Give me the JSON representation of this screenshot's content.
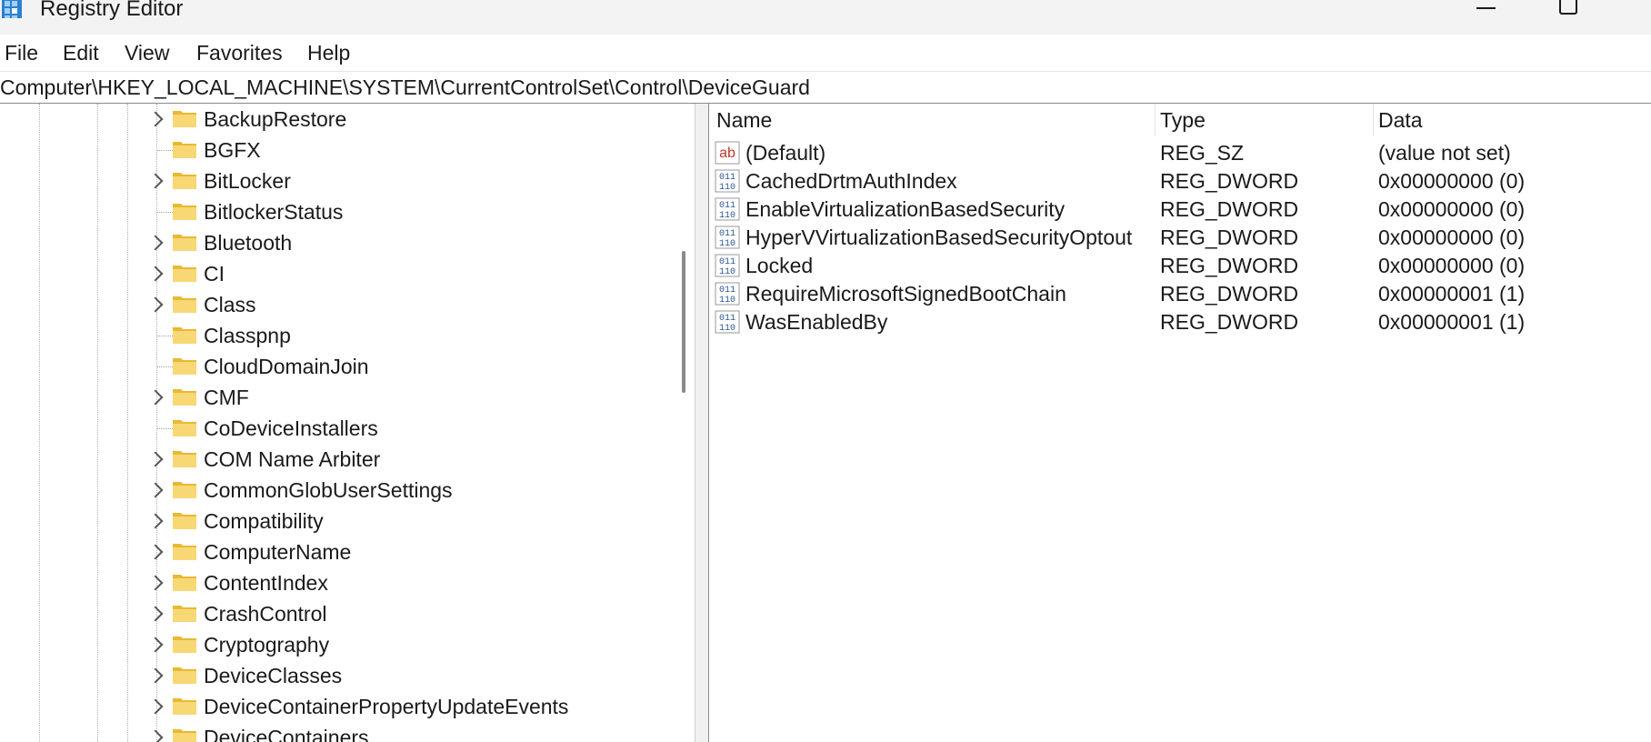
{
  "window": {
    "title": "Registry Editor",
    "app_icon": "registry-editor-icon"
  },
  "menu": {
    "items": [
      {
        "label": "File"
      },
      {
        "label": "Edit"
      },
      {
        "label": "View"
      },
      {
        "label": "Favorites"
      },
      {
        "label": "Help"
      }
    ]
  },
  "address": {
    "path": "Computer\\HKEY_LOCAL_MACHINE\\SYSTEM\\CurrentControlSet\\Control\\DeviceGuard"
  },
  "tree": {
    "items": [
      {
        "label": "BackupRestore",
        "expandable": true
      },
      {
        "label": "BGFX",
        "expandable": false
      },
      {
        "label": "BitLocker",
        "expandable": true
      },
      {
        "label": "BitlockerStatus",
        "expandable": false
      },
      {
        "label": "Bluetooth",
        "expandable": true
      },
      {
        "label": "CI",
        "expandable": true
      },
      {
        "label": "Class",
        "expandable": true
      },
      {
        "label": "Classpnp",
        "expandable": false
      },
      {
        "label": "CloudDomainJoin",
        "expandable": false
      },
      {
        "label": "CMF",
        "expandable": true
      },
      {
        "label": "CoDeviceInstallers",
        "expandable": false
      },
      {
        "label": "COM Name Arbiter",
        "expandable": true
      },
      {
        "label": "CommonGlobUserSettings",
        "expandable": true
      },
      {
        "label": "Compatibility",
        "expandable": true
      },
      {
        "label": "ComputerName",
        "expandable": true
      },
      {
        "label": "ContentIndex",
        "expandable": true
      },
      {
        "label": "CrashControl",
        "expandable": true
      },
      {
        "label": "Cryptography",
        "expandable": true
      },
      {
        "label": "DeviceClasses",
        "expandable": true
      },
      {
        "label": "DeviceContainerPropertyUpdateEvents",
        "expandable": true
      },
      {
        "label": "DeviceContainers",
        "expandable": true
      }
    ]
  },
  "values": {
    "headers": {
      "name": "Name",
      "type": "Type",
      "data": "Data"
    },
    "rows": [
      {
        "icon": "string-value-icon",
        "name": "(Default)",
        "type": "REG_SZ",
        "data": "(value not set)"
      },
      {
        "icon": "binary-value-icon",
        "name": "CachedDrtmAuthIndex",
        "type": "REG_DWORD",
        "data": "0x00000000 (0)"
      },
      {
        "icon": "binary-value-icon",
        "name": "EnableVirtualizationBasedSecurity",
        "type": "REG_DWORD",
        "data": "0x00000000 (0)"
      },
      {
        "icon": "binary-value-icon",
        "name": "HyperVVirtualizationBasedSecurityOptout",
        "type": "REG_DWORD",
        "data": "0x00000000 (0)"
      },
      {
        "icon": "binary-value-icon",
        "name": "Locked",
        "type": "REG_DWORD",
        "data": "0x00000000 (0)"
      },
      {
        "icon": "binary-value-icon",
        "name": "RequireMicrosoftSignedBootChain",
        "type": "REG_DWORD",
        "data": "0x00000001 (1)"
      },
      {
        "icon": "binary-value-icon",
        "name": "WasEnabledBy",
        "type": "REG_DWORD",
        "data": "0x00000001 (1)"
      }
    ]
  },
  "colors": {
    "folder": "#f8d775",
    "folder_dark": "#e8b931",
    "binary_icon": "#2b5797",
    "string_icon": "#c0392b"
  }
}
